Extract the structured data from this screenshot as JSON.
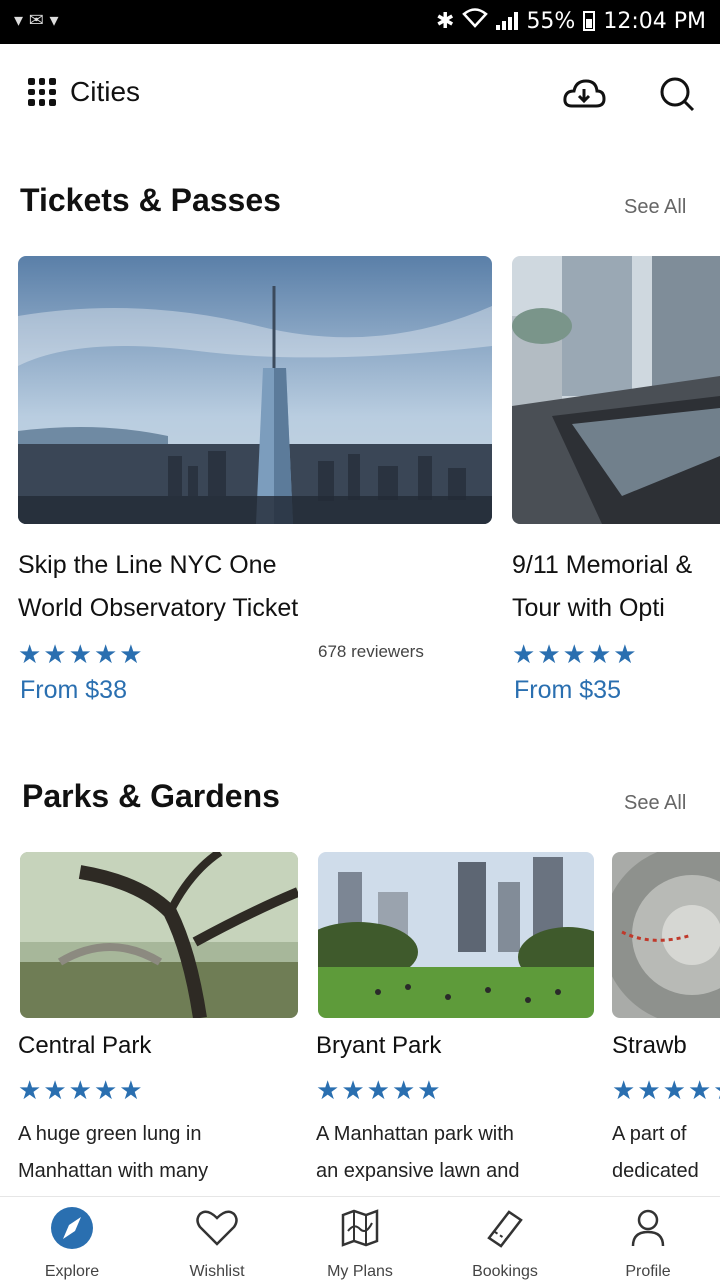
{
  "status_bar": {
    "battery": "55%",
    "time": "12:04 PM"
  },
  "topbar": {
    "city_label": "Cities"
  },
  "sections": {
    "tickets": {
      "title": "Tickets & Passes",
      "see_all": "See All",
      "cards": [
        {
          "title_line1": "Skip the Line NYC One",
          "title_line2": "World Observatory Ticket",
          "rating": 5,
          "reviewers": "678 reviewers",
          "price": "From $38"
        },
        {
          "title_line1": "9/11 Memorial &",
          "title_line2": "Tour with Opti",
          "rating": 5,
          "price": "From $35"
        }
      ]
    },
    "parks": {
      "title": "Parks & Gardens",
      "see_all": "See All",
      "cards": [
        {
          "title": "Central Park",
          "rating": 5,
          "desc_line1": "A huge green lung in",
          "desc_line2": "Manhattan with many"
        },
        {
          "title": "Bryant Park",
          "rating": 5,
          "desc_line1": "A Manhattan park with",
          "desc_line2": "an expansive lawn and"
        },
        {
          "title": "Strawb",
          "rating": 5,
          "desc_line1": "A part of",
          "desc_line2": "dedicated"
        }
      ]
    }
  },
  "bottom_nav": {
    "items": [
      {
        "label": "Explore",
        "icon": "compass-icon",
        "active": true
      },
      {
        "label": "Wishlist",
        "icon": "heart-icon"
      },
      {
        "label": "My Plans",
        "icon": "map-icon"
      },
      {
        "label": "Bookings",
        "icon": "ticket-icon"
      },
      {
        "label": "Profile",
        "icon": "person-icon"
      }
    ]
  },
  "colors": {
    "accent": "#2a6fb0",
    "active_nav": "#2a6fb0"
  }
}
